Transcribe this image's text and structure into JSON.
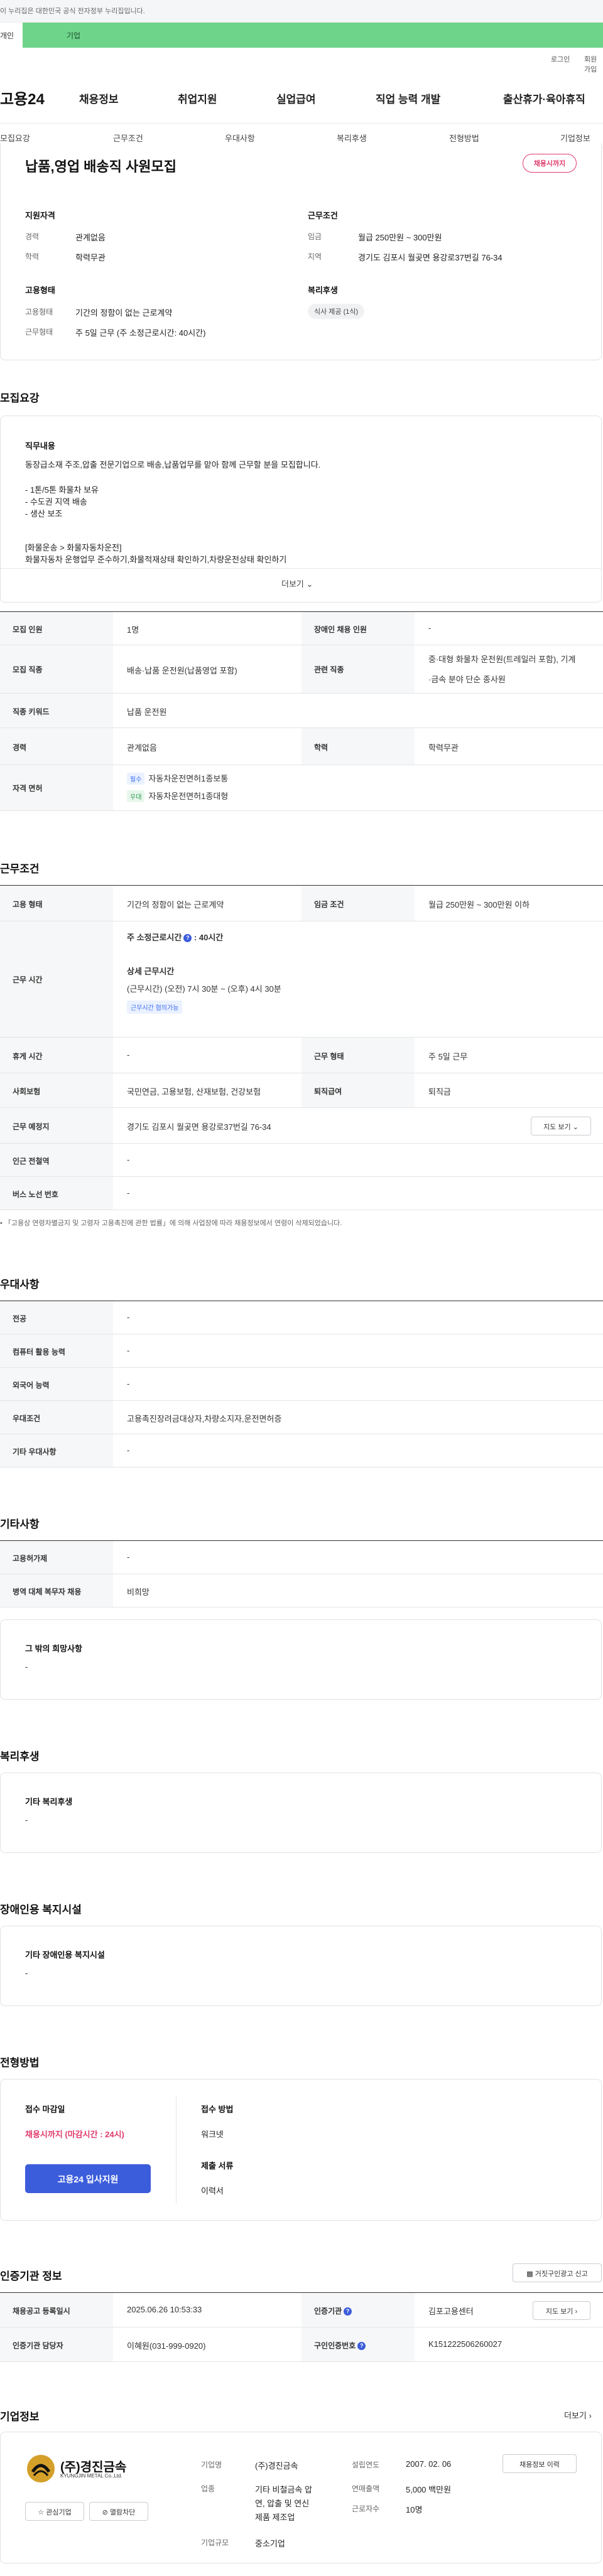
{
  "topbar": {
    "notice": "이 누리집은 대한민국 공식 전자정부 누리집입니다."
  },
  "tabs": {
    "personal": "개인",
    "corporate": "기업"
  },
  "util": {
    "login": "로그인",
    "join": "회원가입"
  },
  "gnb": {
    "logo": "고용24",
    "items": [
      "채용정보",
      "취업지원",
      "실업급여",
      "직업 능력 개발",
      "출산휴가·육아휴직"
    ]
  },
  "subnav": [
    "모집요강",
    "근무조건",
    "우대사항",
    "복리후생",
    "전형방법",
    "기업정보"
  ],
  "header": {
    "title": "납품,영업 배송직 사원모집",
    "badge": "채용시까지",
    "qual_heading": "지원자격",
    "exp_label": "경력",
    "exp_value": "관계없음",
    "edu_label": "학력",
    "edu_value": "학력무관",
    "cond_heading": "근무조건",
    "wage_label": "임금",
    "wage_value": "월급 250만원 ~ 300만원",
    "area_label": "지역",
    "area_value": "경기도 김포시 월곶면 용강로37번길 76-34",
    "emp_heading": "고용형태",
    "type_label": "고용형태",
    "type_value": "기간의 정함이 없는 근로계약",
    "work_label": "근무형태",
    "work_value": "주 5일 근무 (주 소정근로시간: 40시간)",
    "welfare_heading": "복리후생",
    "welfare_badge": "식사 제공 (1식)"
  },
  "recruit": {
    "section_title": "모집요강",
    "job_heading": "직무내용",
    "lines": [
      "동장급소재 주조,압출 전문기업으로 배송,납품업무를 맡아 함께 근무할 분을 모집합니다.",
      "",
      "- 1톤/5톤 화물차 보유",
      "- 수도권 지역 배송",
      "- 생산 보조",
      "",
      "[화물운송 > 화물자동차운전]",
      "화물자동차 운행업무 준수하기,화물적재상태 확인하기,차량운전상태 확인하기"
    ],
    "more": "더보기"
  },
  "recruit_table": {
    "r1": {
      "h1": "모집 인원",
      "v1": "1명",
      "h2": "장애인 채용 인원",
      "v2": "-"
    },
    "r2": {
      "h1": "모집 직종",
      "v1": "배송·납품 운전원(납품영업 포함)",
      "h2": "관련 직종",
      "v2a": "중·대형 화물차 운전원(트레일러 포함), 기계",
      "v2b": "·금속 분야 단순 종사원"
    },
    "r3": {
      "h1": "직종 키워드",
      "v1": "납품 운전원"
    },
    "r4": {
      "h1": "경력",
      "v1": "관계없음",
      "h2": "학력",
      "v2": "학력무관"
    },
    "r5": {
      "h1": "자격 면허",
      "tag1": "필수",
      "lic1": "자동차운전면허1종보통",
      "tag2": "우대",
      "lic2": "자동차운전면허1종대형"
    }
  },
  "cond": {
    "section_title": "근무조건",
    "r1": {
      "h1": "고용 형태",
      "v1": "기간의 정함이 없는 근로계약",
      "h2": "임금 조건",
      "v2": "월급 250만원 ~ 300만원 이하"
    },
    "r2": {
      "h1": "근무 시간",
      "hours": "주 소정근로시간",
      "hours_val": "40시간",
      "detail_h": "상세 근무시간",
      "detail": "(근무시간) (오전) 7시 30분 ~ (오후) 4시 30분",
      "flex": "근무시간 협의가능"
    },
    "r3": {
      "h1": "휴게 시간",
      "v1": "-",
      "h2": "근무 형태",
      "v2": "주 5일 근무"
    },
    "r4": {
      "h1": "사회보험",
      "v1": "국민연금, 고용보험, 산재보험, 건강보험",
      "h2": "퇴직급여",
      "v2": "퇴직금"
    },
    "r5": {
      "h1": "근무 예정지",
      "v1": "경기도 김포시 월곶면 용강로37번길 76-34",
      "btn": "지도 보기"
    },
    "r6": {
      "h1": "인근 전철역",
      "v1": "-"
    },
    "r7": {
      "h1": "버스 노선 번호",
      "v1": "-"
    },
    "note": "「고용상 연령차별금지 및 고령자 고용촉진에 관한 법률」에 의해 사업장에 따라 채용정보에서 연령이 삭제되었습니다."
  },
  "pref": {
    "section_title": "우대사항",
    "rows": [
      {
        "h": "전공",
        "v": "-"
      },
      {
        "h": "컴퓨터 활용 능력",
        "v": "-"
      },
      {
        "h": "외국어 능력",
        "v": "-"
      },
      {
        "h": "우대조건",
        "v": "고용촉진장려금대상자,차량소지자,운전면허증"
      },
      {
        "h": "기타 우대사항",
        "v": "-"
      }
    ]
  },
  "etc": {
    "section_title": "기타사항",
    "rows": [
      {
        "h": "고용허가제",
        "v": "-"
      },
      {
        "h": "병역 대체 복무자 채용",
        "v": "비희망"
      }
    ],
    "box_title": "그 밖의 희망사항",
    "box_val": "-"
  },
  "welfare": {
    "section_title": "복리후생",
    "box_title": "기타 복리후생",
    "box_val": "-"
  },
  "disab": {
    "section_title": "장애인용 복지시설",
    "box_title": "기타 장애인용 복지시설",
    "box_val": "-"
  },
  "process": {
    "section_title": "전형방법",
    "deadline_h": "접수 마감일",
    "deadline": "채용시까지 (마감시간 : 24시)",
    "apply_btn": "고용24 입사지원",
    "method_h": "접수 방법",
    "method": "워크넷",
    "docs_h": "제출 서류",
    "docs": "이력서"
  },
  "agency": {
    "section_title": "인증기관 정보",
    "report_btn": "거짓구인광고 신고",
    "r1": {
      "h1": "채용공고 등록일시",
      "v1": "2025.06.26 10:53:33",
      "h2": "인증기관",
      "v2": "김포고용센터",
      "btn": "지도 보기"
    },
    "r2": {
      "h1": "인증기관 담당자",
      "v1": "이혜원(031-999-0920)",
      "h2": "구인인증번호",
      "v2": "K151222506260027"
    }
  },
  "company": {
    "section_title": "기업정보",
    "more": "더보기",
    "logo_text": "(주)경진금속",
    "logo_en": "KYUNGJIN METAL Co.,Ltd.",
    "fav_btn": "관심기업",
    "block_btn": "열람차단",
    "name_h": "기업명",
    "name": "(주)경진금속",
    "biz_h": "업종",
    "biz": [
      "기타 비철금속 압",
      "연, 압출 및 연신",
      "제품 제조업"
    ],
    "scale_h": "기업규모",
    "scale": "중소기업",
    "est_h": "설립연도",
    "est": "2007. 02. 06",
    "sales_h": "연매출액",
    "sales": "5,000 백만원",
    "emp_h": "근로자수",
    "emp": "10명",
    "hire_btn": "채용정보 이력"
  }
}
